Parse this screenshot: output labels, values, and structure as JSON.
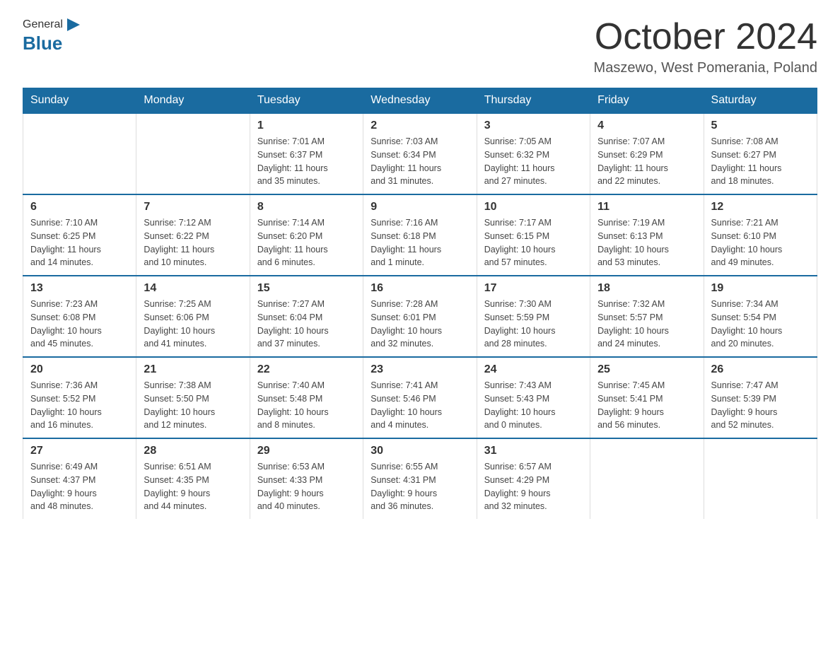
{
  "header": {
    "logo_general": "General",
    "logo_blue": "Blue",
    "month_title": "October 2024",
    "location": "Maszewo, West Pomerania, Poland"
  },
  "weekdays": [
    "Sunday",
    "Monday",
    "Tuesday",
    "Wednesday",
    "Thursday",
    "Friday",
    "Saturday"
  ],
  "weeks": [
    [
      {
        "day": "",
        "info": ""
      },
      {
        "day": "",
        "info": ""
      },
      {
        "day": "1",
        "info": "Sunrise: 7:01 AM\nSunset: 6:37 PM\nDaylight: 11 hours\nand 35 minutes."
      },
      {
        "day": "2",
        "info": "Sunrise: 7:03 AM\nSunset: 6:34 PM\nDaylight: 11 hours\nand 31 minutes."
      },
      {
        "day": "3",
        "info": "Sunrise: 7:05 AM\nSunset: 6:32 PM\nDaylight: 11 hours\nand 27 minutes."
      },
      {
        "day": "4",
        "info": "Sunrise: 7:07 AM\nSunset: 6:29 PM\nDaylight: 11 hours\nand 22 minutes."
      },
      {
        "day": "5",
        "info": "Sunrise: 7:08 AM\nSunset: 6:27 PM\nDaylight: 11 hours\nand 18 minutes."
      }
    ],
    [
      {
        "day": "6",
        "info": "Sunrise: 7:10 AM\nSunset: 6:25 PM\nDaylight: 11 hours\nand 14 minutes."
      },
      {
        "day": "7",
        "info": "Sunrise: 7:12 AM\nSunset: 6:22 PM\nDaylight: 11 hours\nand 10 minutes."
      },
      {
        "day": "8",
        "info": "Sunrise: 7:14 AM\nSunset: 6:20 PM\nDaylight: 11 hours\nand 6 minutes."
      },
      {
        "day": "9",
        "info": "Sunrise: 7:16 AM\nSunset: 6:18 PM\nDaylight: 11 hours\nand 1 minute."
      },
      {
        "day": "10",
        "info": "Sunrise: 7:17 AM\nSunset: 6:15 PM\nDaylight: 10 hours\nand 57 minutes."
      },
      {
        "day": "11",
        "info": "Sunrise: 7:19 AM\nSunset: 6:13 PM\nDaylight: 10 hours\nand 53 minutes."
      },
      {
        "day": "12",
        "info": "Sunrise: 7:21 AM\nSunset: 6:10 PM\nDaylight: 10 hours\nand 49 minutes."
      }
    ],
    [
      {
        "day": "13",
        "info": "Sunrise: 7:23 AM\nSunset: 6:08 PM\nDaylight: 10 hours\nand 45 minutes."
      },
      {
        "day": "14",
        "info": "Sunrise: 7:25 AM\nSunset: 6:06 PM\nDaylight: 10 hours\nand 41 minutes."
      },
      {
        "day": "15",
        "info": "Sunrise: 7:27 AM\nSunset: 6:04 PM\nDaylight: 10 hours\nand 37 minutes."
      },
      {
        "day": "16",
        "info": "Sunrise: 7:28 AM\nSunset: 6:01 PM\nDaylight: 10 hours\nand 32 minutes."
      },
      {
        "day": "17",
        "info": "Sunrise: 7:30 AM\nSunset: 5:59 PM\nDaylight: 10 hours\nand 28 minutes."
      },
      {
        "day": "18",
        "info": "Sunrise: 7:32 AM\nSunset: 5:57 PM\nDaylight: 10 hours\nand 24 minutes."
      },
      {
        "day": "19",
        "info": "Sunrise: 7:34 AM\nSunset: 5:54 PM\nDaylight: 10 hours\nand 20 minutes."
      }
    ],
    [
      {
        "day": "20",
        "info": "Sunrise: 7:36 AM\nSunset: 5:52 PM\nDaylight: 10 hours\nand 16 minutes."
      },
      {
        "day": "21",
        "info": "Sunrise: 7:38 AM\nSunset: 5:50 PM\nDaylight: 10 hours\nand 12 minutes."
      },
      {
        "day": "22",
        "info": "Sunrise: 7:40 AM\nSunset: 5:48 PM\nDaylight: 10 hours\nand 8 minutes."
      },
      {
        "day": "23",
        "info": "Sunrise: 7:41 AM\nSunset: 5:46 PM\nDaylight: 10 hours\nand 4 minutes."
      },
      {
        "day": "24",
        "info": "Sunrise: 7:43 AM\nSunset: 5:43 PM\nDaylight: 10 hours\nand 0 minutes."
      },
      {
        "day": "25",
        "info": "Sunrise: 7:45 AM\nSunset: 5:41 PM\nDaylight: 9 hours\nand 56 minutes."
      },
      {
        "day": "26",
        "info": "Sunrise: 7:47 AM\nSunset: 5:39 PM\nDaylight: 9 hours\nand 52 minutes."
      }
    ],
    [
      {
        "day": "27",
        "info": "Sunrise: 6:49 AM\nSunset: 4:37 PM\nDaylight: 9 hours\nand 48 minutes."
      },
      {
        "day": "28",
        "info": "Sunrise: 6:51 AM\nSunset: 4:35 PM\nDaylight: 9 hours\nand 44 minutes."
      },
      {
        "day": "29",
        "info": "Sunrise: 6:53 AM\nSunset: 4:33 PM\nDaylight: 9 hours\nand 40 minutes."
      },
      {
        "day": "30",
        "info": "Sunrise: 6:55 AM\nSunset: 4:31 PM\nDaylight: 9 hours\nand 36 minutes."
      },
      {
        "day": "31",
        "info": "Sunrise: 6:57 AM\nSunset: 4:29 PM\nDaylight: 9 hours\nand 32 minutes."
      },
      {
        "day": "",
        "info": ""
      },
      {
        "day": "",
        "info": ""
      }
    ]
  ]
}
